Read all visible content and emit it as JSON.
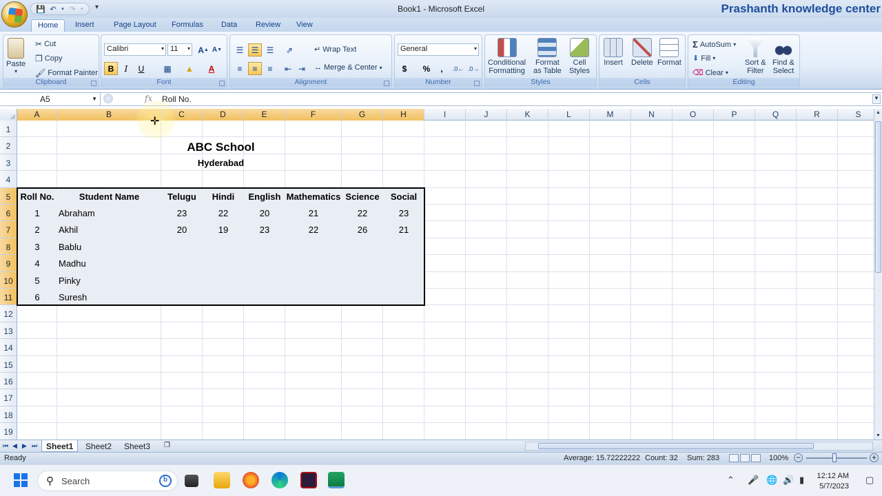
{
  "window": {
    "title": "Book1 - Microsoft Excel",
    "watermark": "Prashanth knowledge center"
  },
  "ribbon_tabs": [
    "Home",
    "Insert",
    "Page Layout",
    "Formulas",
    "Data",
    "Review",
    "View"
  ],
  "clipboard": {
    "paste": "Paste",
    "cut": "Cut",
    "copy": "Copy",
    "format_painter": "Format Painter",
    "label": "Clipboard"
  },
  "font": {
    "name": "Calibri",
    "size": "11",
    "label": "Font",
    "bold": "B",
    "italic": "I",
    "underline": "U"
  },
  "alignment": {
    "wrap": "Wrap Text",
    "merge": "Merge & Center",
    "label": "Alignment"
  },
  "number": {
    "format": "General",
    "label": "Number",
    "currency": "$",
    "percent": "%",
    "comma": ","
  },
  "styles": {
    "conditional_1": "Conditional",
    "conditional_2": "Formatting",
    "table_1": "Format",
    "table_2": "as Table",
    "cell_1": "Cell",
    "cell_2": "Styles",
    "label": "Styles"
  },
  "cells": {
    "insert": "Insert",
    "delete": "Delete",
    "format": "Format",
    "label": "Cells"
  },
  "editing": {
    "autosum": "AutoSum",
    "fill": "Fill",
    "clear": "Clear",
    "sort_1": "Sort &",
    "sort_2": "Filter",
    "find_1": "Find &",
    "find_2": "Select",
    "label": "Editing"
  },
  "formula_bar": {
    "name_box": "A5",
    "fx": "fx",
    "content": "Roll No."
  },
  "columns": [
    "A",
    "B",
    "C",
    "D",
    "E",
    "F",
    "G",
    "H",
    "I",
    "J",
    "K",
    "L",
    "M",
    "N",
    "O",
    "P",
    "Q",
    "R",
    "S"
  ],
  "rows": [
    "1",
    "2",
    "3",
    "4",
    "5",
    "6",
    "7",
    "8",
    "9",
    "10",
    "11",
    "12",
    "13",
    "14",
    "15",
    "16",
    "17",
    "18",
    "19"
  ],
  "sheet": {
    "title": "ABC School",
    "subtitle": "Hyderabad",
    "headers": [
      "Roll No.",
      "Student Name",
      "Telugu",
      "Hindi",
      "English",
      "Mathematics",
      "Science",
      "Social"
    ],
    "records": [
      [
        "1",
        "Abraham",
        "23",
        "22",
        "20",
        "21",
        "22",
        "23"
      ],
      [
        "2",
        "Akhil",
        "20",
        "19",
        "23",
        "22",
        "26",
        "21"
      ],
      [
        "3",
        "Bablu",
        "",
        "",
        "",
        "",
        "",
        ""
      ],
      [
        "4",
        "Madhu",
        "",
        "",
        "",
        "",
        "",
        ""
      ],
      [
        "5",
        "Pinky",
        "",
        "",
        "",
        "",
        "",
        ""
      ],
      [
        "6",
        "Suresh",
        "",
        "",
        "",
        "",
        "",
        ""
      ]
    ]
  },
  "sheet_tabs": [
    "Sheet1",
    "Sheet2",
    "Sheet3"
  ],
  "status": {
    "ready": "Ready",
    "average": "Average: 15.72222222",
    "count": "Count: 32",
    "sum": "Sum: 283",
    "zoom": "100%"
  },
  "taskbar": {
    "search": "Search",
    "time": "12:12 AM",
    "date": "5/7/2023"
  }
}
